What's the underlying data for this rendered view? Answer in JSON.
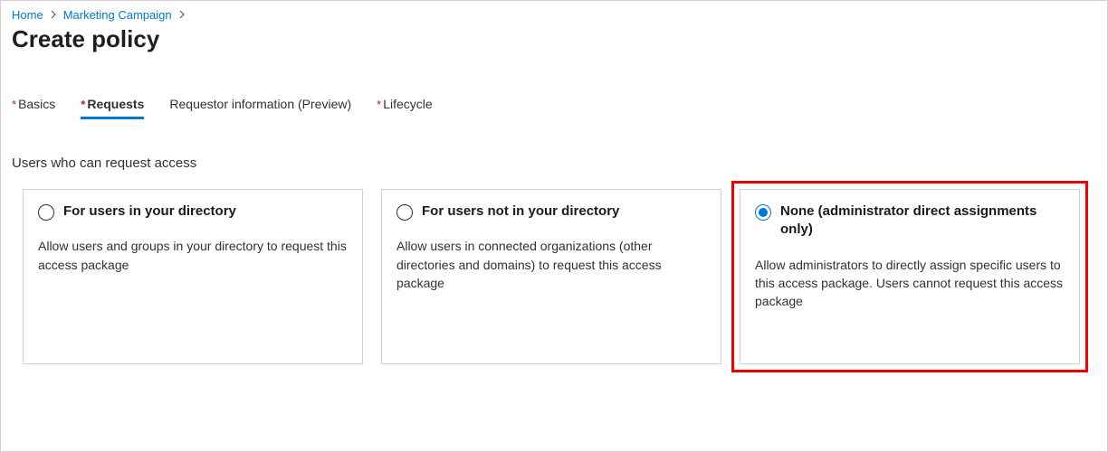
{
  "breadcrumb": {
    "items": [
      {
        "label": "Home"
      },
      {
        "label": "Marketing Campaign"
      }
    ]
  },
  "page": {
    "title": "Create policy"
  },
  "tabs": [
    {
      "label": "Basics",
      "required": true,
      "active": false
    },
    {
      "label": "Requests",
      "required": true,
      "active": true
    },
    {
      "label": "Requestor information (Preview)",
      "required": false,
      "active": false
    },
    {
      "label": "Lifecycle",
      "required": true,
      "active": false
    }
  ],
  "section": {
    "label": "Users who can request access"
  },
  "cards": [
    {
      "title": "For users in your directory",
      "desc": "Allow users and groups in your directory to request this access package",
      "selected": false
    },
    {
      "title": "For users not in your directory",
      "desc": "Allow users in connected organizations (other directories and domains) to request this access package",
      "selected": false
    },
    {
      "title": "None (administrator direct assignments only)",
      "desc": "Allow administrators to directly assign specific users to this access package. Users cannot request this access package",
      "selected": true
    }
  ]
}
